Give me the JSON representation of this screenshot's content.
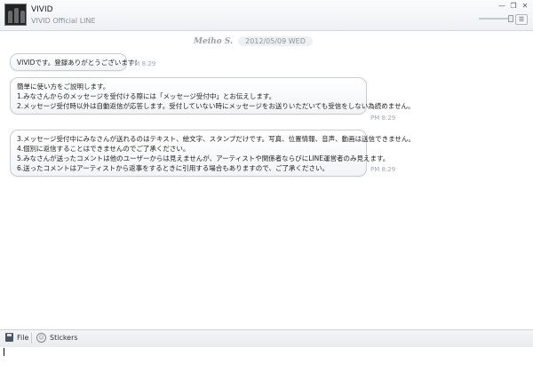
{
  "header": {
    "contact_name": "VIVID",
    "contact_subtitle": "VIVID Official LINE",
    "window_controls": [
      "minimize-icon",
      "restore-icon",
      "close-icon"
    ],
    "menu_icon": "list-icon"
  },
  "chat": {
    "date_logo": "Meiho S.",
    "date": "2012/05/09 WED",
    "messages": [
      {
        "lines": [
          "VIVIDです。登録ありがとうございます！"
        ],
        "time": "PM 8:29"
      },
      {
        "lines": [
          "簡単に使い方をご説明します。",
          "1.みなさんからのメッセージを受付ける際には「メッセージ受付中」とお伝えします。",
          "2.メッセージ受付時以外は自動返信が応答します。受付していない時にメッセージをお送りいただいても受信をしない為読めません。"
        ],
        "time": "PM 8:29"
      },
      {
        "lines": [
          "3.メッセージ受付中にみなさんが送れるのはテキスト、絵文字、スタンプだけです。写真、位置情報、音声、動画は送信できません。",
          "4.個別に返信することはできませんのでご了承ください。",
          "5.みなさんが送ったコメントは他のユーザーからは見えませんが、アーティストや関係者ならびにLINE運営者のみ見えます。",
          "6.送ったコメントはアーティストから返事をするときに引用する場合もありますので、ご了承ください。"
        ],
        "time": "PM 8:29"
      }
    ]
  },
  "toolbar": {
    "file_label": "File",
    "stickers_label": "Stickers"
  },
  "input": {
    "value": ""
  },
  "colors": {
    "bubble_border": "#c9cdd3",
    "timestamp": "#a3a9b0",
    "header_bg": "#eef1f4"
  }
}
